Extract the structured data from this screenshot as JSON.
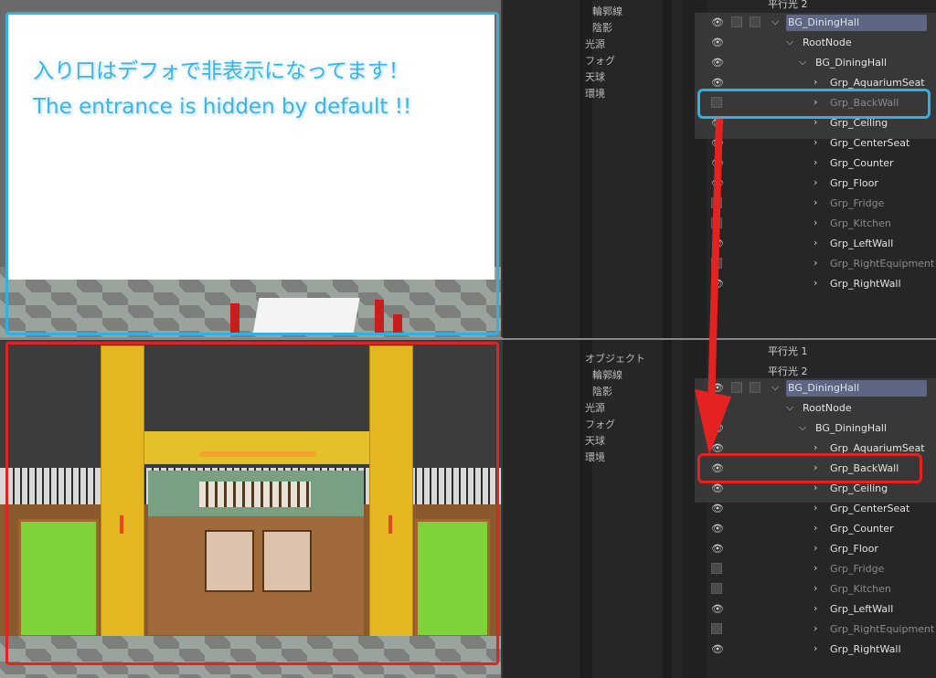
{
  "caption": {
    "jp": "入り口はデフォで非表示になってます！",
    "en": "The entrance is hidden by default !!"
  },
  "panel_top": {
    "lights": [
      "平行光 2"
    ],
    "props": [
      "輪郭線",
      "陰影",
      "光源",
      "フォグ",
      "天球",
      "環境"
    ],
    "rows": [
      {
        "label": "BG_DiningHall",
        "visible": true
      },
      {
        "label": "RootNode",
        "visible": true
      },
      {
        "label": "BG_DiningHall",
        "visible": true
      },
      {
        "label": "Grp_AquariumSeat",
        "visible": true
      },
      {
        "label": "Grp_BackWall",
        "visible": false
      },
      {
        "label": "Grp_Ceiling",
        "visible": true
      },
      {
        "label": "Grp_CenterSeat",
        "visible": true
      },
      {
        "label": "Grp_Counter",
        "visible": true
      },
      {
        "label": "Grp_Floor",
        "visible": true
      },
      {
        "label": "Grp_Fridge",
        "visible": false
      },
      {
        "label": "Grp_Kitchen",
        "visible": false
      },
      {
        "label": "Grp_LeftWall",
        "visible": true
      },
      {
        "label": "Grp_RightEquipment",
        "visible": false
      },
      {
        "label": "Grp_RightWall",
        "visible": true
      }
    ]
  },
  "panel_bot": {
    "lights": [
      "平行光 1",
      "平行光 2"
    ],
    "props": [
      "オブジェクト",
      "輪郭線",
      "陰影",
      "光源",
      "フォグ",
      "天球",
      "環境"
    ],
    "rows": [
      {
        "label": "BG_DiningHall",
        "visible": true
      },
      {
        "label": "RootNode",
        "visible": true
      },
      {
        "label": "BG_DiningHall",
        "visible": true
      },
      {
        "label": "Grp_AquariumSeat",
        "visible": true
      },
      {
        "label": "Grp_BackWall",
        "visible": true
      },
      {
        "label": "Grp_Ceiling",
        "visible": true
      },
      {
        "label": "Grp_CenterSeat",
        "visible": true
      },
      {
        "label": "Grp_Counter",
        "visible": true
      },
      {
        "label": "Grp_Floor",
        "visible": true
      },
      {
        "label": "Grp_Fridge",
        "visible": false
      },
      {
        "label": "Grp_Kitchen",
        "visible": false
      },
      {
        "label": "Grp_LeftWall",
        "visible": true
      },
      {
        "label": "Grp_RightEquipment",
        "visible": false
      },
      {
        "label": "Grp_RightWall",
        "visible": true
      }
    ]
  },
  "colors": {
    "highlight_blue": "#2eb2e4",
    "highlight_red": "#e42222",
    "selection": "#5d6785"
  }
}
